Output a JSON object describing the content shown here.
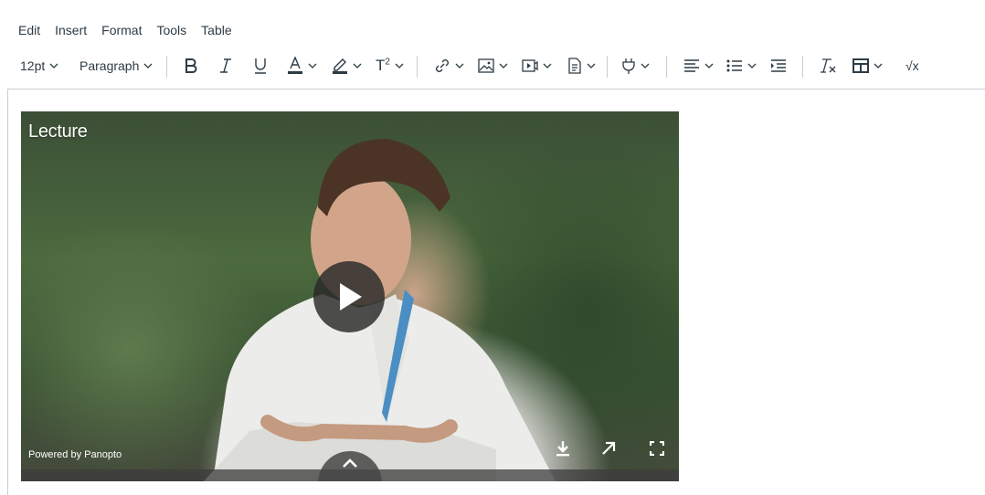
{
  "menubar": {
    "items": [
      "Edit",
      "Insert",
      "Format",
      "Tools",
      "Table"
    ]
  },
  "toolbar": {
    "font_size": "12pt",
    "block_format": "Paragraph",
    "superscript_label": "T",
    "superscript_sup": "2",
    "icons": [
      "bold-icon",
      "italic-icon",
      "underline-icon",
      "text-color-icon",
      "highlight-icon",
      "superscript-icon",
      "link-icon",
      "image-icon",
      "media-icon",
      "document-icon",
      "apps-plug-icon",
      "align-icon",
      "list-icon",
      "indent-icon",
      "clear-formatting-icon",
      "table-icon",
      "equation-icon"
    ],
    "equation_label": "√x",
    "colors": {
      "text_color_bar": "#2d3b45",
      "separator": "#c7cdd1"
    }
  },
  "video": {
    "title": "Lecture",
    "powered_by": "Powered by Panopto"
  }
}
